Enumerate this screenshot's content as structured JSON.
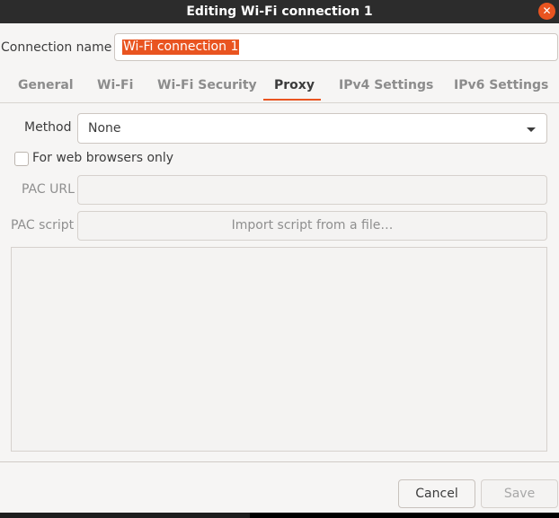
{
  "window": {
    "title": "Editing Wi-Fi connection 1",
    "close_icon": "close-icon",
    "close_glyph": "✕"
  },
  "connection": {
    "label": "Connection name",
    "value": "Wi-Fi connection 1"
  },
  "tabs": [
    {
      "label": "General",
      "active": false
    },
    {
      "label": "Wi-Fi",
      "active": false
    },
    {
      "label": "Wi-Fi Security",
      "active": false
    },
    {
      "label": "Proxy",
      "active": true
    },
    {
      "label": "IPv4 Settings",
      "active": false
    },
    {
      "label": "IPv6 Settings",
      "active": false
    }
  ],
  "proxy": {
    "method_label": "Method",
    "method_value": "None",
    "browsers_only_label": "For web browsers only",
    "browsers_only_checked": false,
    "pac_url_label": "PAC URL",
    "pac_url_value": "",
    "pac_script_label": "PAC script",
    "import_label": "Import script from a file…"
  },
  "footer": {
    "cancel_label": "Cancel",
    "save_label": "Save"
  },
  "colors": {
    "accent": "#e95420",
    "titlebar": "#2c2c2c",
    "background": "#f6f5f4"
  }
}
